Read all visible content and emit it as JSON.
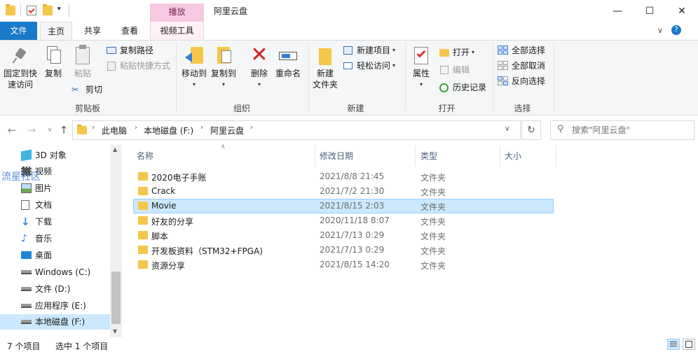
{
  "window": {
    "title": "阿里云盘",
    "contextual_tab_group": "播放",
    "minimize": "—",
    "maximize": "☐",
    "close": "✕"
  },
  "ribbon_tabs": {
    "file": "文件",
    "home": "主页",
    "share": "共享",
    "view": "查看",
    "video_tools": "视频工具"
  },
  "ribbon": {
    "clipboard": {
      "label": "剪贴板",
      "pin": "固定到快速访问",
      "pin_line1": "固定到快",
      "pin_line2": "速访问",
      "copy": "复制",
      "paste": "粘贴",
      "copy_path": "复制路径",
      "paste_shortcut": "粘贴快捷方式",
      "cut": "剪切"
    },
    "organize": {
      "label": "组织",
      "move_to": "移动到",
      "copy_to": "复制到",
      "delete": "删除",
      "rename": "重命名"
    },
    "new": {
      "label": "新建",
      "new_folder_line1": "新建",
      "new_folder_line2": "文件夹",
      "new_item": "新建项目",
      "easy_access": "轻松访问"
    },
    "open": {
      "label": "打开",
      "properties": "属性",
      "open": "打开",
      "edit": "编辑",
      "history": "历史记录"
    },
    "select": {
      "label": "选择",
      "select_all": "全部选择",
      "select_none": "全部取消",
      "invert": "反向选择"
    }
  },
  "address": {
    "crumbs": [
      "此电脑",
      "本地磁盘 (F:)",
      "阿里云盘"
    ],
    "search_placeholder": "搜索\"阿里云盘\""
  },
  "nav": {
    "items": [
      {
        "label": "3D 对象",
        "icon": "3d-objects-icon"
      },
      {
        "label": "视频",
        "icon": "video-icon"
      },
      {
        "label": "图片",
        "icon": "pictures-icon"
      },
      {
        "label": "文档",
        "icon": "documents-icon"
      },
      {
        "label": "下载",
        "icon": "download-icon"
      },
      {
        "label": "音乐",
        "icon": "music-icon"
      },
      {
        "label": "桌面",
        "icon": "desktop-icon"
      },
      {
        "label": "Windows (C:)",
        "icon": "drive-icon"
      },
      {
        "label": "文件 (D:)",
        "icon": "drive-icon"
      },
      {
        "label": "应用程序 (E:)",
        "icon": "drive-icon"
      },
      {
        "label": "本地磁盘 (F:)",
        "icon": "drive-icon",
        "selected": true
      }
    ],
    "watermark": "流星社区"
  },
  "columns": {
    "name": "名称",
    "date": "修改日期",
    "type": "类型",
    "size": "大小"
  },
  "files": [
    {
      "name": "2020电子手账",
      "date": "2021/8/8 21:45",
      "type": "文件夹"
    },
    {
      "name": "Crack",
      "date": "2021/7/2 21:30",
      "type": "文件夹"
    },
    {
      "name": "Movie",
      "date": "2021/8/15 2:03",
      "type": "文件夹",
      "selected": true
    },
    {
      "name": "好友的分享",
      "date": "2020/11/18 8:07",
      "type": "文件夹"
    },
    {
      "name": "脚本",
      "date": "2021/7/13 0:29",
      "type": "文件夹"
    },
    {
      "name": "开发板资料（STM32+FPGA)",
      "date": "2021/7/13 0:29",
      "type": "文件夹"
    },
    {
      "name": "资源分享",
      "date": "2021/8/15 14:20",
      "type": "文件夹"
    }
  ],
  "status": {
    "count": "7 个项目",
    "selected": "选中 1 个项目"
  },
  "colors": {
    "accent": "#1979ca",
    "selection": "#cce8ff",
    "folder": "#f6c64b",
    "video_tools_tab": "#f7c8e1"
  }
}
